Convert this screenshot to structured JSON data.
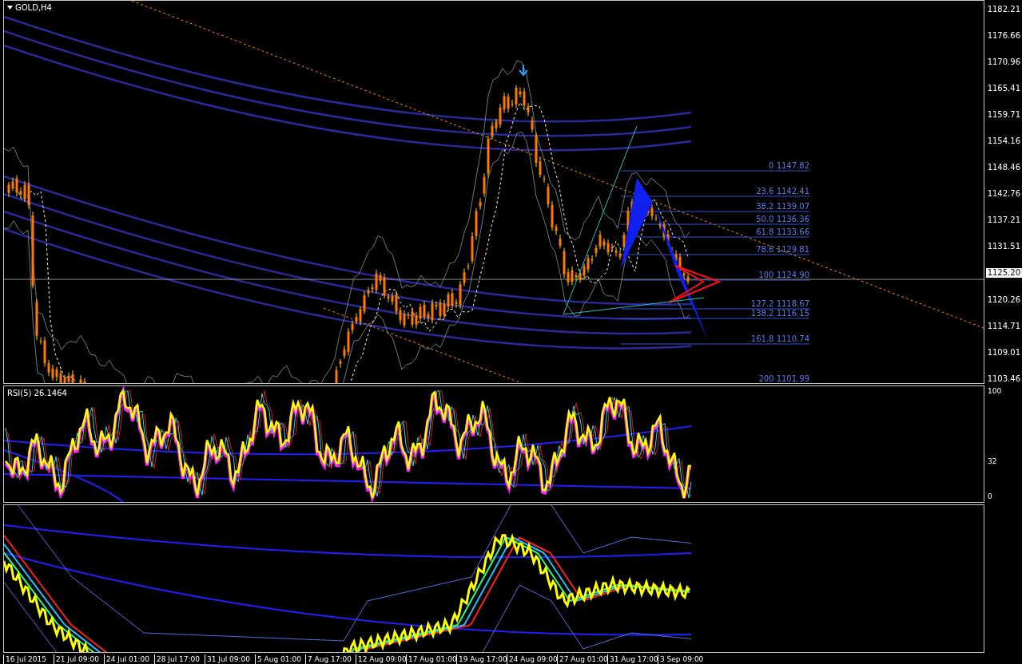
{
  "chart": {
    "title": "GOLD,H4",
    "price_axis": [
      {
        "kind": "tick",
        "label": "1182.21"
      },
      {
        "kind": "tick",
        "label": "1176.66"
      },
      {
        "kind": "tick",
        "label": "1170.96"
      },
      {
        "kind": "tick",
        "label": "1165.41"
      },
      {
        "kind": "tick",
        "label": "1159.71"
      },
      {
        "kind": "tick",
        "label": "1154.16"
      },
      {
        "kind": "tick",
        "label": "1148.46"
      },
      {
        "kind": "tick",
        "label": "1142.76"
      },
      {
        "kind": "tick",
        "label": "1137.21"
      },
      {
        "kind": "tick",
        "label": "1131.51"
      },
      {
        "kind": "current",
        "label": "1125.20"
      },
      {
        "kind": "tick",
        "label": "1120.26"
      },
      {
        "kind": "tick",
        "label": "1114.71"
      },
      {
        "kind": "tick",
        "label": "1109.01"
      },
      {
        "kind": "tick",
        "label": "1103.46"
      }
    ],
    "fib_levels": [
      "0 1147.82",
      "23.6 1142.41",
      "38.2 1139.07",
      "50.0 1136.36",
      "61.8 1133.66",
      "78.6 1129.81",
      "100 1124.90",
      "127.2 1118.67",
      "138.2 1116.15",
      "161.8 1110.74",
      "200 1101.99"
    ]
  },
  "rsi": {
    "label": "RSI(5) 26.1464",
    "axis": [
      "100",
      "32",
      "0"
    ]
  },
  "time_axis": [
    "16 Jul 2015",
    "21 Jul 09:00",
    "24 Jul 01:00",
    "28 Jul 17:00",
    "31 Jul 09:00",
    "5 Aug 01:00",
    "7 Aug 17:00",
    "12 Aug 09:00",
    "17 Aug 01:00",
    "19 Aug 17:00",
    "24 Aug 09:00",
    "27 Aug 01:00",
    "31 Aug 17:00",
    "3 Sep 09:00"
  ]
}
